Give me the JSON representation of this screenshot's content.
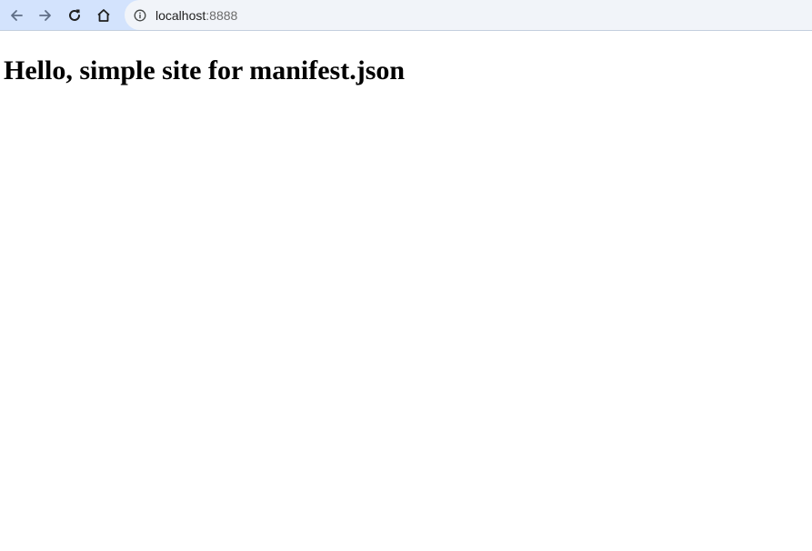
{
  "browser": {
    "nav": {
      "back_icon": "arrow-left-icon",
      "forward_icon": "arrow-right-icon",
      "reload_icon": "reload-icon",
      "home_icon": "home-icon"
    },
    "address_bar": {
      "site_info_icon": "info-icon",
      "host": "localhost",
      "port": ":8888"
    },
    "colors": {
      "toolbar_bg": "#d3e3fd",
      "omnibox_bg": "#f1f4f9"
    }
  },
  "page": {
    "heading": "Hello, simple site for manifest.json"
  }
}
